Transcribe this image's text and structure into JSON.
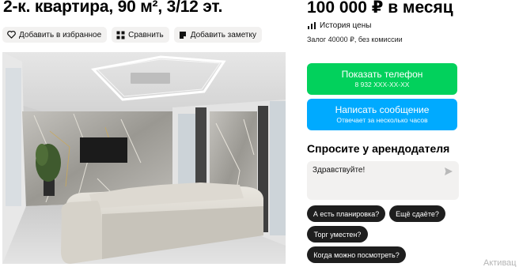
{
  "listing": {
    "title": "2-к. квартира, 90 м², 3/12 эт.",
    "actions": {
      "favorite_label": "Добавить в избранное",
      "compare_label": "Сравнить",
      "note_label": "Добавить заметку"
    }
  },
  "sidebar": {
    "price": "100 000 ₽ в месяц",
    "price_history_label": "История цены",
    "deposit_text": "Залог 40000 ₽, без комиссии",
    "phone_button": {
      "label": "Показать телефон",
      "sublabel": "8 932 XXX-XX-XX"
    },
    "message_button": {
      "label": "Написать сообщение",
      "sublabel": "Отвечает за несколько часов"
    },
    "ask_title": "Спросите у арендодателя",
    "message_input_value": "Здравствуйте!",
    "quick_questions": [
      "А есть планировка?",
      "Ещё сдаёте?",
      "Торг уместен?",
      "Когда можно посмотреть?"
    ]
  },
  "watermark": "Активац",
  "colors": {
    "phone_button": "#02d15c",
    "message_button": "#00aaff",
    "chip_background": "#1e1e1e",
    "action_background": "#f2f1f0"
  },
  "icons": [
    "heart-icon",
    "compare-icon",
    "note-icon",
    "price-history-icon",
    "send-icon"
  ]
}
